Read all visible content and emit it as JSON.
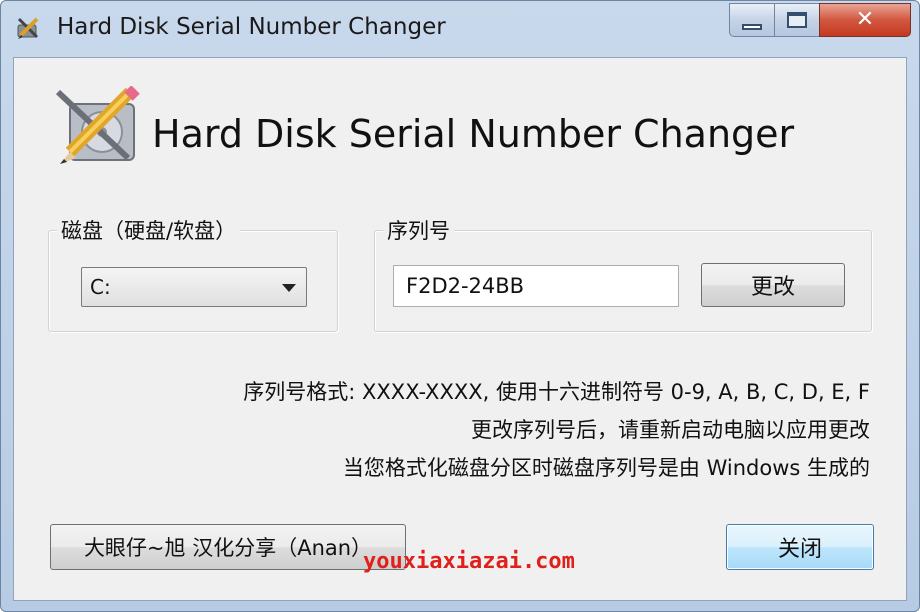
{
  "window": {
    "title": "Hard Disk Serial Number Changer",
    "accent_color": "#c33a20",
    "frame_color": "#b7cbe4"
  },
  "caption_buttons": {
    "minimize_icon": "minimize-icon",
    "maximize_icon": "maximize-icon",
    "close_icon": "close-icon",
    "close_glyph": "✕"
  },
  "header": {
    "title": "Hard Disk Serial Number Changer",
    "logo_icon": "hard-disk-pencil-icon"
  },
  "disk_group": {
    "label": "磁盘（硬盘/软盘）",
    "selected_drive": "C:"
  },
  "serial_group": {
    "label": "序列号",
    "serial_value": "F2D2-24BB",
    "change_button_label": "更改"
  },
  "info": {
    "line1": "序列号格式: XXXX-XXXX, 使用十六进制符号 0-9, A, B, C, D, E, F",
    "line2": "更改序列号后，请重新启动电脑以应用更改",
    "line3": "当您格式化磁盘分区时磁盘序列号是由 Windows 生成的"
  },
  "footer": {
    "credit_label": "大眼仔~旭 汉化分享（Anan）",
    "close_button_label": "关闭",
    "watermark": "youxiaxiazai.com"
  }
}
